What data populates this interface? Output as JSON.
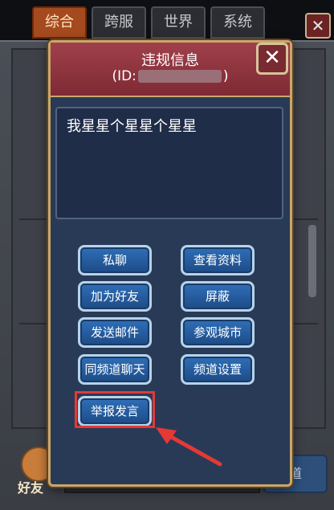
{
  "tabs": [
    {
      "label": "综合"
    },
    {
      "label": "跨服"
    },
    {
      "label": "世界"
    },
    {
      "label": "系统"
    }
  ],
  "background_chat": {
    "friend_label": "好友",
    "send_label": "道"
  },
  "dialog": {
    "title": "违规信息",
    "id_prefix": "(ID:",
    "id_suffix": ")",
    "message": "我星星个星星个星星",
    "close_icon": "✕",
    "buttons": {
      "private_chat": "私聊",
      "view_profile": "查看资料",
      "add_friend": "加为好友",
      "block": "屏蔽",
      "send_mail": "发送邮件",
      "visit_city": "参观城市",
      "channel_chat": "同频道聊天",
      "channel_settings": "频道设置",
      "report": "举报发言"
    }
  },
  "colors": {
    "header_red": "#8b313b",
    "dialog_bg": "#293a57",
    "button_blue": "#2f6fb8",
    "highlight_red": "#e53935",
    "active_tab": "#a54a1e"
  }
}
